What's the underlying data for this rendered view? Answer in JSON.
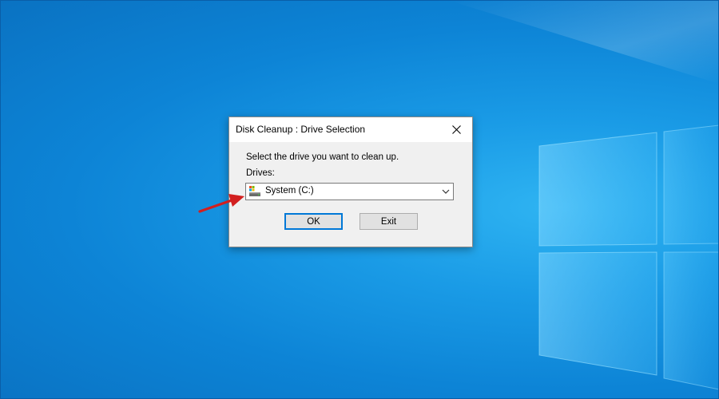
{
  "dialog": {
    "title": "Disk Cleanup : Drive Selection",
    "prompt": "Select the drive you want to clean up.",
    "drives_label": "Drives:",
    "selected_drive": "System (C:)",
    "ok_label": "OK",
    "exit_label": "Exit"
  },
  "icons": {
    "close": "close-icon",
    "drive": "drive-icon",
    "dropdown": "chevron-down-icon",
    "annotation": "arrow-icon"
  },
  "colors": {
    "desktop_blue": "#0d84d6",
    "default_button_border": "#0078d7",
    "annotation_arrow": "#d21f1f"
  }
}
